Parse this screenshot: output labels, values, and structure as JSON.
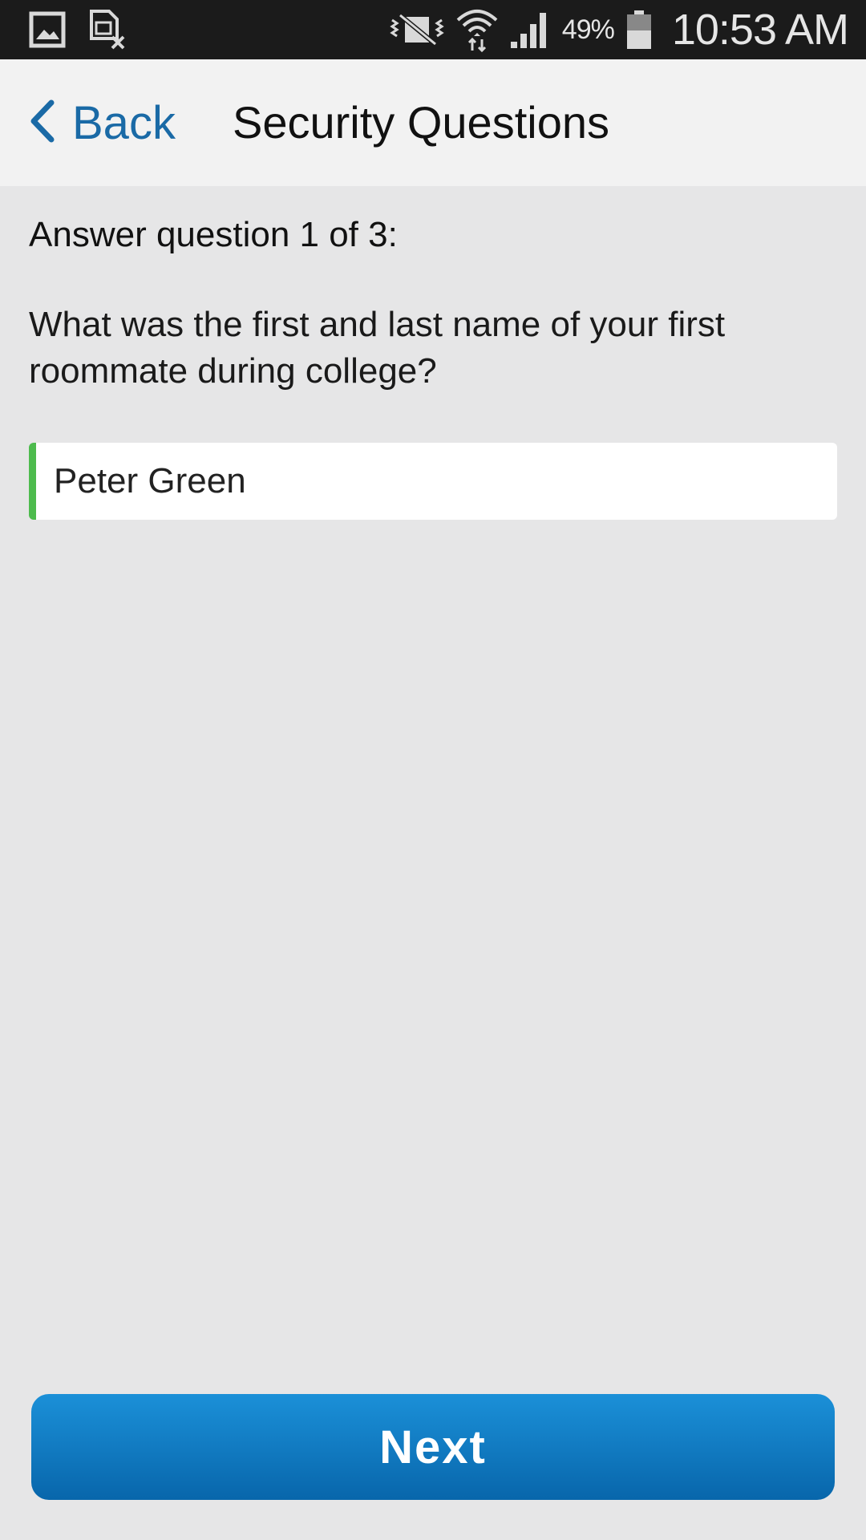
{
  "status_bar": {
    "battery_percent": "49%",
    "time": "10:53 AM",
    "left_icons": [
      "gallery-icon",
      "sim-error-icon"
    ],
    "right_icons": [
      "vibrate-mute-icon",
      "wifi-icon",
      "signal-icon",
      "battery-icon"
    ]
  },
  "header": {
    "back_label": "Back",
    "title": "Security Questions"
  },
  "content": {
    "progress_label": "Answer question 1 of 3:",
    "question": "What was the first and last name of your first roommate during college?",
    "answer_value": "Peter Green"
  },
  "footer": {
    "next_label": "Next"
  },
  "colors": {
    "accent_blue": "#1a6aa6",
    "valid_green": "#4dbb4d",
    "button_blue": "#0b74bd"
  }
}
